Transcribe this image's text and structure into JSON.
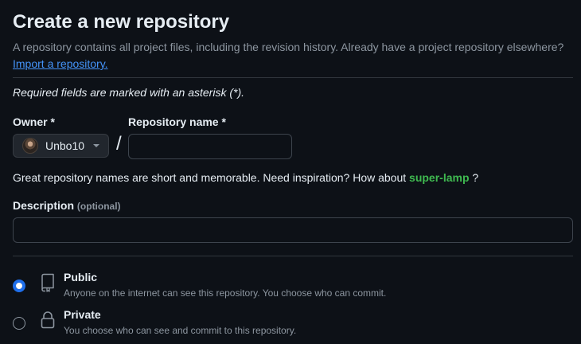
{
  "header": {
    "title": "Create a new repository",
    "subtitle": "A repository contains all project files, including the revision history. Already have a project repository elsewhere?",
    "import_link": "Import a repository."
  },
  "form": {
    "required_note": "Required fields are marked with an asterisk (*).",
    "owner": {
      "label": "Owner *",
      "value": "Unbo10"
    },
    "separator": "/",
    "repo_name": {
      "label": "Repository name *",
      "value": "",
      "placeholder": ""
    },
    "suggestion": {
      "prefix": "Great repository names are short and memorable. Need inspiration? How about",
      "name": "super-lamp",
      "suffix": "?"
    },
    "description": {
      "label": "Description",
      "optional": "(optional)",
      "value": "",
      "placeholder": ""
    },
    "visibility": [
      {
        "title": "Public",
        "description": "Anyone on the internet can see this repository. You choose who can commit.",
        "icon": "repo-icon",
        "selected": true
      },
      {
        "title": "Private",
        "description": "You choose who can see and commit to this repository.",
        "icon": "lock-icon",
        "selected": false
      }
    ]
  },
  "colors": {
    "background": "#0d1117",
    "text": "#e6edf3",
    "muted": "#8d96a0",
    "link": "#4493f8",
    "suggestion": "#3fb950",
    "radio_accent": "#1f6feb",
    "border": "#30363d"
  }
}
